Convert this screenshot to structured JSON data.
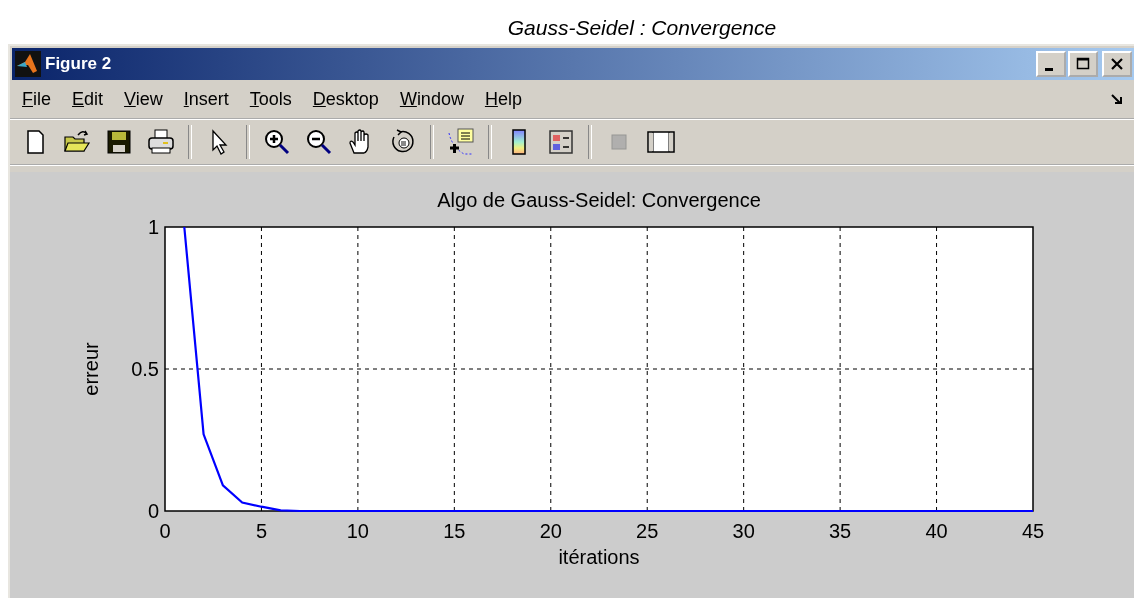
{
  "caption": "Gauss-Seidel : Convergence",
  "window": {
    "title": "Figure 2"
  },
  "menu": [
    "File",
    "Edit",
    "View",
    "Insert",
    "Tools",
    "Desktop",
    "Window",
    "Help"
  ],
  "toolbar": [
    {
      "kind": "new",
      "disabled": false
    },
    {
      "kind": "open",
      "disabled": false
    },
    {
      "kind": "save",
      "disabled": false
    },
    {
      "kind": "print",
      "disabled": false
    },
    {
      "kind": "sep"
    },
    {
      "kind": "pointer",
      "disabled": false
    },
    {
      "kind": "sep"
    },
    {
      "kind": "zoomin",
      "disabled": false
    },
    {
      "kind": "zoomout",
      "disabled": false
    },
    {
      "kind": "pan",
      "disabled": false
    },
    {
      "kind": "rotate",
      "disabled": false
    },
    {
      "kind": "sep"
    },
    {
      "kind": "datacursor",
      "disabled": false
    },
    {
      "kind": "sep"
    },
    {
      "kind": "colorbar",
      "disabled": false
    },
    {
      "kind": "legend",
      "disabled": false
    },
    {
      "kind": "sep"
    },
    {
      "kind": "square",
      "disabled": true
    },
    {
      "kind": "plottools",
      "disabled": false
    }
  ],
  "figure": {
    "chart_data": {
      "type": "line",
      "title": "Algo de Gauss-Seidel: Convergence",
      "xlabel": "itérations",
      "ylabel": "erreur",
      "x": [
        1,
        2,
        3,
        4,
        5,
        6,
        7,
        8,
        9,
        10,
        11,
        12,
        13,
        14,
        15,
        16,
        17,
        18,
        19,
        20,
        21,
        22,
        23,
        24,
        25,
        26,
        27,
        28,
        29,
        30,
        31,
        32,
        33,
        34,
        35,
        36,
        37,
        38,
        39,
        40,
        41,
        42,
        43,
        44,
        45
      ],
      "series": [
        {
          "color": "#0000ff",
          "values": [
            1,
            0.27,
            0.09,
            0.03,
            0.015,
            0.002,
            0,
            0,
            0,
            0,
            0,
            0,
            0,
            0,
            0,
            0,
            0,
            0,
            0,
            0,
            0,
            0,
            0,
            0,
            0,
            0,
            0,
            0,
            0,
            0,
            0,
            0,
            0,
            0,
            0,
            0,
            0,
            0,
            0,
            0,
            0,
            0,
            0,
            0,
            0
          ]
        }
      ],
      "grid": true,
      "xlim": [
        0,
        45
      ],
      "ylim": [
        0,
        1
      ],
      "xticks": [
        0,
        5,
        10,
        15,
        20,
        25,
        30,
        35,
        40,
        45
      ],
      "yticks": [
        0,
        0.5,
        1
      ]
    }
  }
}
